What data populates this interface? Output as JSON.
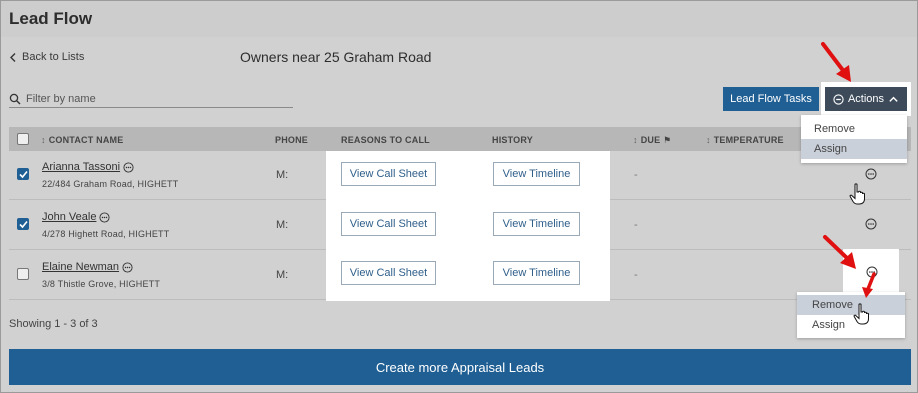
{
  "app": {
    "title": "Lead Flow"
  },
  "nav": {
    "back_label": "Back to Lists"
  },
  "list": {
    "title": "Owners near 25 Graham Road"
  },
  "filter": {
    "placeholder": "Filter by name"
  },
  "toolbar": {
    "tasks_label": "Lead Flow Tasks",
    "actions_label": "Actions"
  },
  "actions_menu": {
    "items": [
      "Remove",
      "Assign"
    ],
    "hovered": "Assign"
  },
  "table": {
    "headers": {
      "contact": "CONTACT NAME",
      "phone": "PHONE",
      "reasons": "REASONS TO CALL",
      "history": "HISTORY",
      "due": "DUE",
      "temperature": "TEMPERATURE"
    },
    "rows": [
      {
        "name": "Arianna Tassoni",
        "address": "22/484 Graham Road, HIGHETT",
        "phone": "M:",
        "reasons_btn": "View Call Sheet",
        "history_btn": "View Timeline",
        "due": "-",
        "checked": true
      },
      {
        "name": "John Veale",
        "address": "4/278 Highett Road, HIGHETT",
        "phone": "M:",
        "reasons_btn": "View Call Sheet",
        "history_btn": "View Timeline",
        "due": "-",
        "checked": true
      },
      {
        "name": "Elaine Newman",
        "address": "3/8 Thistle Grove, HIGHETT",
        "phone": "M:",
        "reasons_btn": "View Call Sheet",
        "history_btn": "View Timeline",
        "due": "-",
        "checked": false
      }
    ]
  },
  "row_menu": {
    "items": [
      "Remove",
      "Assign"
    ],
    "hovered": "Remove"
  },
  "footer": {
    "showing": "Showing 1 - 3 of 3",
    "create_label": "Create more Appraisal Leads"
  },
  "colors": {
    "primary": "#1f5f94",
    "actions_btn": "#3c4a5a",
    "annotation_arrow": "#e01010",
    "menu_hover": "#c9d0da"
  }
}
